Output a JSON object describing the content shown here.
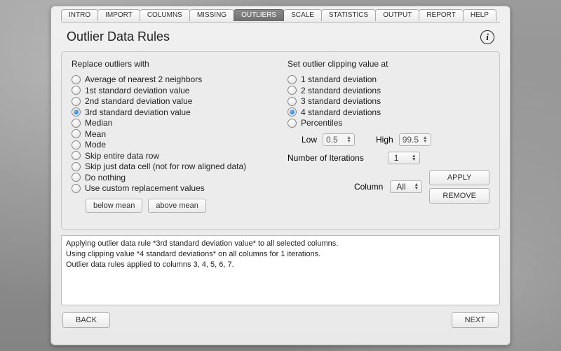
{
  "tabs": [
    "INTRO",
    "IMPORT",
    "COLUMNS",
    "MISSING",
    "OUTLIERS",
    "SCALE",
    "STATISTICS",
    "OUTPUT",
    "REPORT",
    "HELP"
  ],
  "active_tab_index": 4,
  "title": "Outlier Data Rules",
  "replace": {
    "group_label": "Replace outliers with",
    "options": [
      "Average of nearest 2 neighbors",
      "1st standard deviation value",
      "2nd standard deviation value",
      "3rd standard deviation value",
      "Median",
      "Mean",
      "Mode",
      "Skip entire data row",
      "Skip just data cell (not for row aligned data)",
      "Do nothing",
      "Use custom replacement values"
    ],
    "selected_index": 3,
    "below_mean_label": "below mean",
    "above_mean_label": "above mean"
  },
  "clipping": {
    "group_label": "Set outlier clipping value at",
    "options": [
      "1 standard deviation",
      "2 standard deviations",
      "3 standard deviations",
      "4 standard deviations",
      "Percentiles"
    ],
    "selected_index": 3,
    "low_label": "Low",
    "low_value": "0.5",
    "high_label": "High",
    "high_value": "99.5",
    "iterations_label": "Number of Iterations",
    "iterations_value": "1",
    "column_label": "Column",
    "column_value": "All",
    "apply_label": "APPLY",
    "remove_label": "REMOVE"
  },
  "log": {
    "lines": [
      "Applying outlier data rule *3rd standard deviation value* to all selected columns.",
      "Using clipping value *4 standard deviations* on all columns for 1 iterations.",
      "Outlier data rules applied to columns 3, 4, 5, 6, 7."
    ]
  },
  "footer": {
    "back_label": "BACK",
    "next_label": "NEXT"
  }
}
